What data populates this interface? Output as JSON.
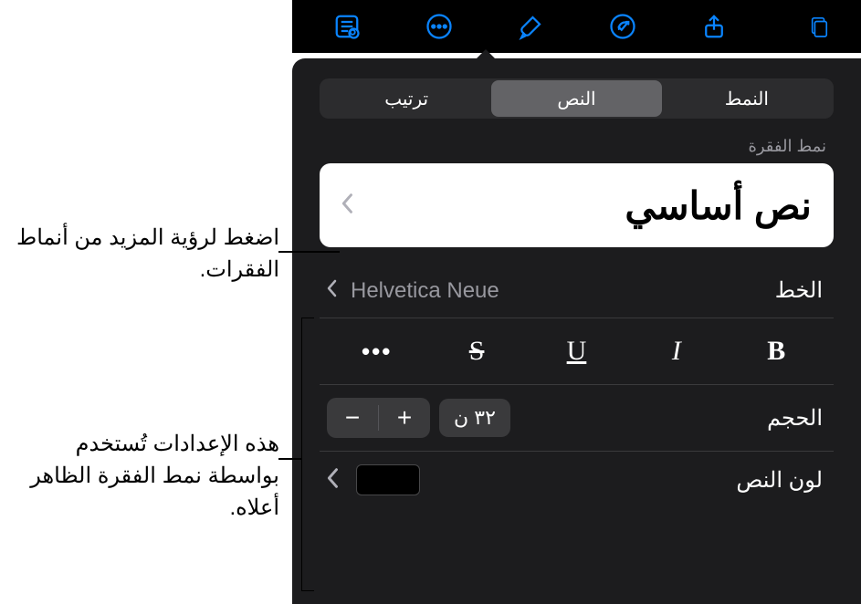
{
  "toolbar": {
    "icons": [
      "share-icon",
      "redo-icon",
      "brush-icon",
      "more-icon",
      "read-icon",
      "doc-icon"
    ]
  },
  "tabs": {
    "style": "النمط",
    "text": "النص",
    "arrange": "ترتيب",
    "selected": "text"
  },
  "section": {
    "paragraph_style_label": "نمط الفقرة"
  },
  "paragraph_style": {
    "name": "نص أساسي"
  },
  "font": {
    "label": "الخط",
    "value": "Helvetica Neue"
  },
  "style_buttons": {
    "bold": "B",
    "italic": "I",
    "underline": "U",
    "strike": "S",
    "more": "•••"
  },
  "size": {
    "label": "الحجم",
    "value": "٣٢ ن",
    "plus": "+",
    "minus": "−"
  },
  "text_color": {
    "label": "لون النص",
    "value": "#000000"
  },
  "callouts": {
    "c1": "اضغط لرؤية المزيد من أنماط الفقرات.",
    "c2": "هذه الإعدادات تُستخدم بواسطة نمط الفقرة الظاهر أعلاه."
  }
}
